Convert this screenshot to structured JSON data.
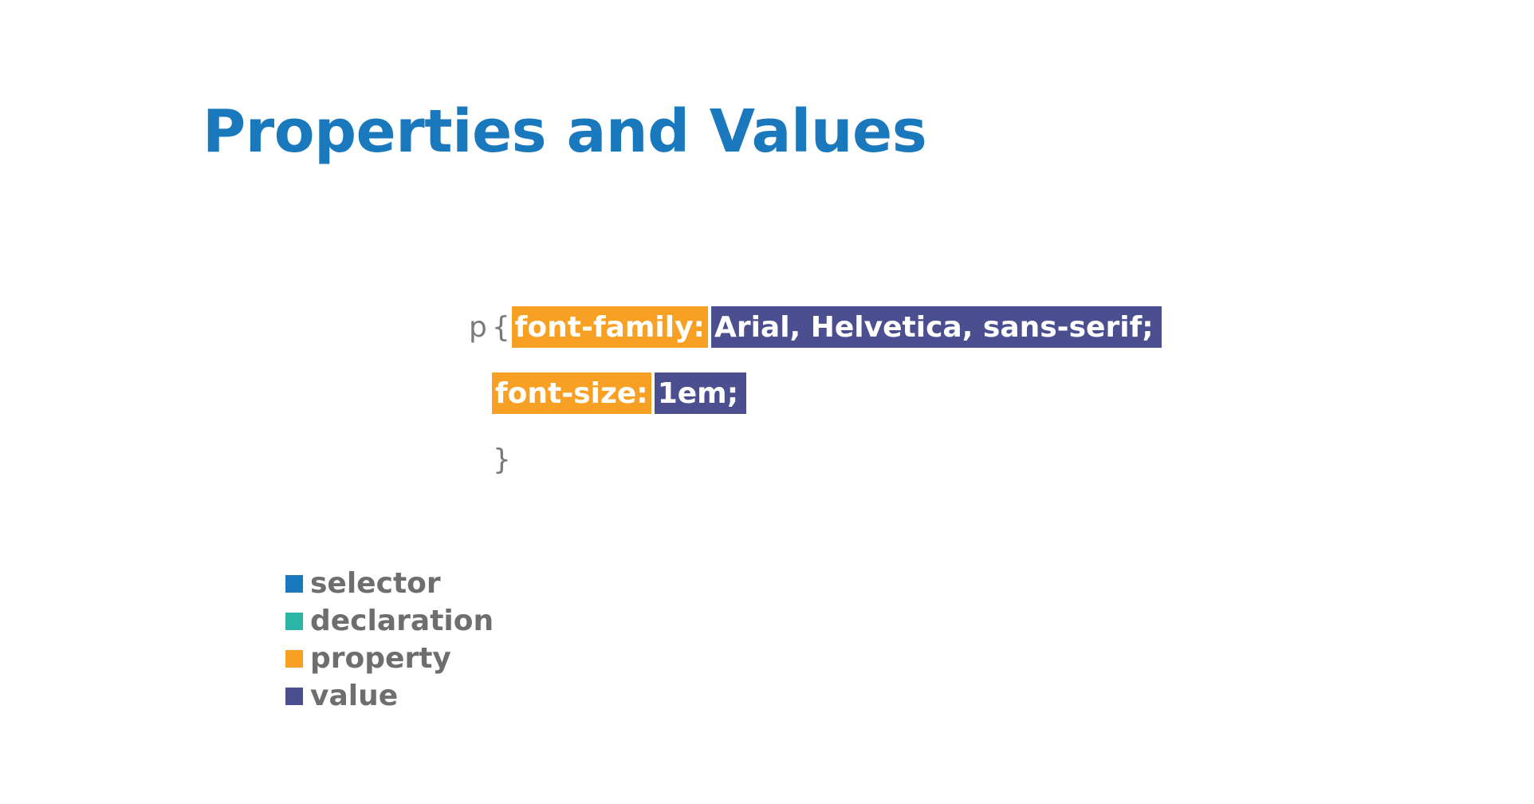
{
  "slide": {
    "title": "Properties and Values",
    "code": {
      "selector": "p",
      "brace_open": "{",
      "brace_close": "}",
      "declarations": [
        {
          "property": "font-family:",
          "value": "Arial, Helvetica, sans-serif;"
        },
        {
          "property": "font-size:",
          "value": "1em;"
        }
      ]
    },
    "legend": [
      {
        "label": "selector",
        "color": "#1a78bd"
      },
      {
        "label": "declaration",
        "color": "#2ab5a5"
      },
      {
        "label": "property",
        "color": "#f7a023"
      },
      {
        "label": "value",
        "color": "#4b4f8f"
      }
    ]
  }
}
